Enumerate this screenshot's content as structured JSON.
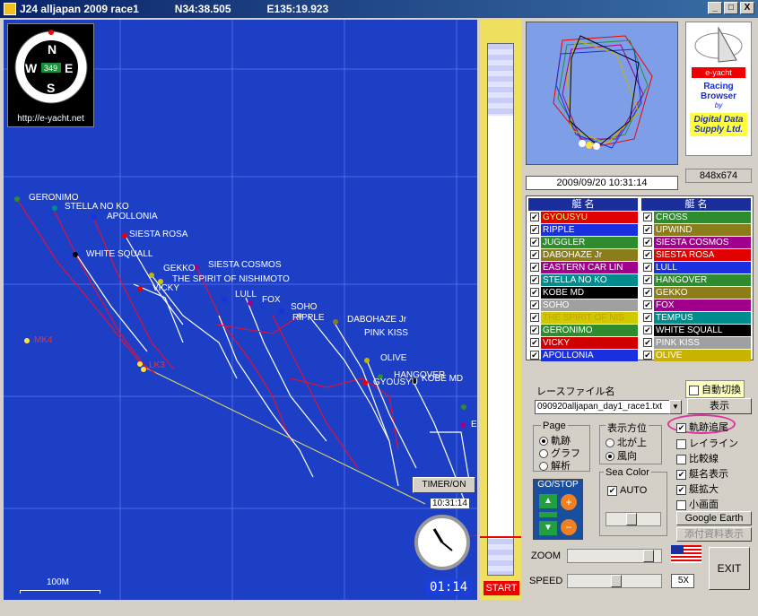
{
  "window": {
    "title": "J24 alljapan 2009 race1",
    "lat": "N34:38.505",
    "lon": "E135:19.923",
    "buttons": [
      "_",
      "□",
      "X"
    ]
  },
  "compass": {
    "heading": "349",
    "url": "http://e-yacht.net",
    "letters": [
      "N",
      "E",
      "S",
      "W"
    ]
  },
  "map": {
    "marks": [
      {
        "label": "MK4"
      },
      {
        "label": "LK3"
      }
    ],
    "scale_label": "100M",
    "boat_labels": [
      "GERONIMO",
      "STELLA NO KO",
      "APOLLONIA",
      "SIESTA ROSA",
      "WHITE SQUALL",
      "GEKKO",
      "SIESTA COSMOS",
      "THE SPIRIT OF NISHIMOTO",
      "VICKY",
      "LULL",
      "FOX",
      "SOHO",
      "RIPPLE",
      "DABOHAZE Jr",
      "PINK KISS",
      "OLIVE",
      "HANGOVER",
      "GYOUSYU",
      "KOBE MD",
      "E"
    ],
    "timer_button": "TIMER/ON",
    "clock_time": "10:31:14",
    "elapsed": "01:14"
  },
  "timeline": {
    "start_label": "START"
  },
  "preview": {
    "datetime": "2009/09/20 10:31:14",
    "size": "848x674"
  },
  "logo": {
    "brand": "e-yacht",
    "line1": "Racing",
    "line2": "Browser",
    "by": "by",
    "company": "Digital Data Supply Ltd."
  },
  "boatlist": {
    "header": "艇 名",
    "left": [
      {
        "name": "GYOUSYU",
        "color": "#e00000",
        "text": "#ffff60"
      },
      {
        "name": "RIPPLE",
        "color": "#1a2fe0",
        "text": "#ffffff"
      },
      {
        "name": "JUGGLER",
        "color": "#2e8b2e",
        "text": "#ffffff"
      },
      {
        "name": "DABOHAZE Jr",
        "color": "#8b7d1a",
        "text": "#ffffff"
      },
      {
        "name": "EASTERN CAR LIN",
        "color": "#a0008c",
        "text": "#ffffff"
      },
      {
        "name": "STELLA NO KO",
        "color": "#008c8c",
        "text": "#ffffff"
      },
      {
        "name": "KOBE MD",
        "color": "#000000",
        "text": "#ffffff"
      },
      {
        "name": "SOHO",
        "color": "#a0a0a0",
        "text": "#ffffff"
      },
      {
        "name": "THE SPIRIT OF NIS",
        "color": "#d0c800",
        "text": "#c8a000"
      },
      {
        "name": "GERONIMO",
        "color": "#2e8b2e",
        "text": "#ffffff"
      },
      {
        "name": "VICKY",
        "color": "#d00000",
        "text": "#ffffff"
      },
      {
        "name": "APOLLONIA",
        "color": "#1a2fe0",
        "text": "#ffffff"
      }
    ],
    "right": [
      {
        "name": "CROSS",
        "color": "#2e8b2e",
        "text": "#ffffff"
      },
      {
        "name": "UPWIND",
        "color": "#8b7d1a",
        "text": "#ffffff"
      },
      {
        "name": "SIESTA COSMOS",
        "color": "#a0008c",
        "text": "#ffffff"
      },
      {
        "name": "SIESTA ROSA",
        "color": "#e00000",
        "text": "#ffffff"
      },
      {
        "name": "LULL",
        "color": "#1a2fe0",
        "text": "#ffffff"
      },
      {
        "name": "HANGOVER",
        "color": "#2e8b2e",
        "text": "#ffffff"
      },
      {
        "name": "GEKKO",
        "color": "#8b7d1a",
        "text": "#ffffff"
      },
      {
        "name": "FOX",
        "color": "#a0008c",
        "text": "#ffffff"
      },
      {
        "name": "TEMPUS",
        "color": "#008c8c",
        "text": "#ffffff"
      },
      {
        "name": "WHITE SQUALL",
        "color": "#000000",
        "text": "#ffffff"
      },
      {
        "name": "PINK KISS",
        "color": "#a0a0a0",
        "text": "#ffffff"
      },
      {
        "name": "OLIVE",
        "color": "#c8b400",
        "text": "#ffffff"
      }
    ]
  },
  "controls": {
    "race_file_label": "レースファイル名",
    "auto_switch": "自動切換",
    "race_file": "090920alljapan_day1_race1.txt",
    "show_button": "表示",
    "page_label": "Page",
    "page_options": [
      "軌跡",
      "グラフ",
      "解析"
    ],
    "dir_label": "表示方位",
    "dir_options": [
      "北が上",
      "風向"
    ],
    "trail": "軌跡追尾",
    "layline": "レイライン",
    "compare": "比較線",
    "name_show": "艇名表示",
    "boat_zoom": "艇拡大",
    "small_screen": "小画面",
    "google_earth": "Google Earth",
    "attach": "添付資料表示",
    "go_stop": "GO/STOP",
    "sea_color": "Sea Color",
    "auto": "AUTO",
    "zoom": "ZOOM",
    "speed": "SPEED",
    "speed_value": "5X",
    "exit": "EXIT"
  }
}
